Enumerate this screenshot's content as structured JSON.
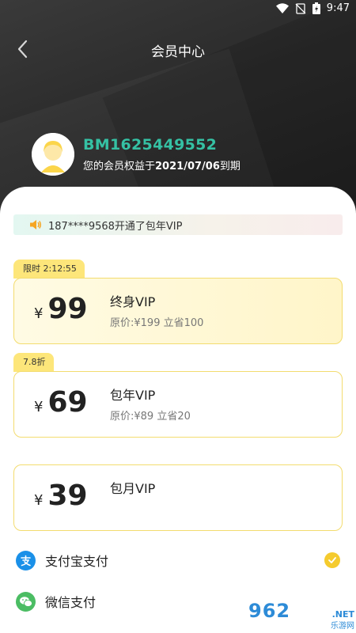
{
  "status_bar": {
    "time": "9:47"
  },
  "nav": {
    "title": "会员中心"
  },
  "user": {
    "name": "BM1625449552",
    "expiry_prefix": "您的会员权益于",
    "expiry_date": "2021/07/06",
    "expiry_suffix": "到期"
  },
  "notice": {
    "text": "187****9568开通了包年VIP"
  },
  "plans": [
    {
      "tag": "限时 2:12:55",
      "currency": "¥",
      "price": "99",
      "name": "终身VIP",
      "original": "原价:¥199 立省100",
      "selected": true
    },
    {
      "tag": "7.8折",
      "currency": "¥",
      "price": "69",
      "name": "包年VIP",
      "original": "原价:¥89 立省20",
      "selected": false
    },
    {
      "tag": "",
      "currency": "¥",
      "price": "39",
      "name": "包月VIP",
      "original": "",
      "selected": false
    }
  ],
  "payment": [
    {
      "label": "支付宝支付",
      "selected": true
    },
    {
      "label": "微信支付",
      "selected": false
    }
  ],
  "watermark": {
    "brand": "962",
    "suffix": ".NET",
    "cn": "乐游网"
  },
  "colors": {
    "accent_green": "#35c1a4",
    "gold": "#f5cb2e",
    "tag_yellow": "#fde67a",
    "alipay_blue": "#1a90e8",
    "wechat_green": "#4bbd63"
  }
}
